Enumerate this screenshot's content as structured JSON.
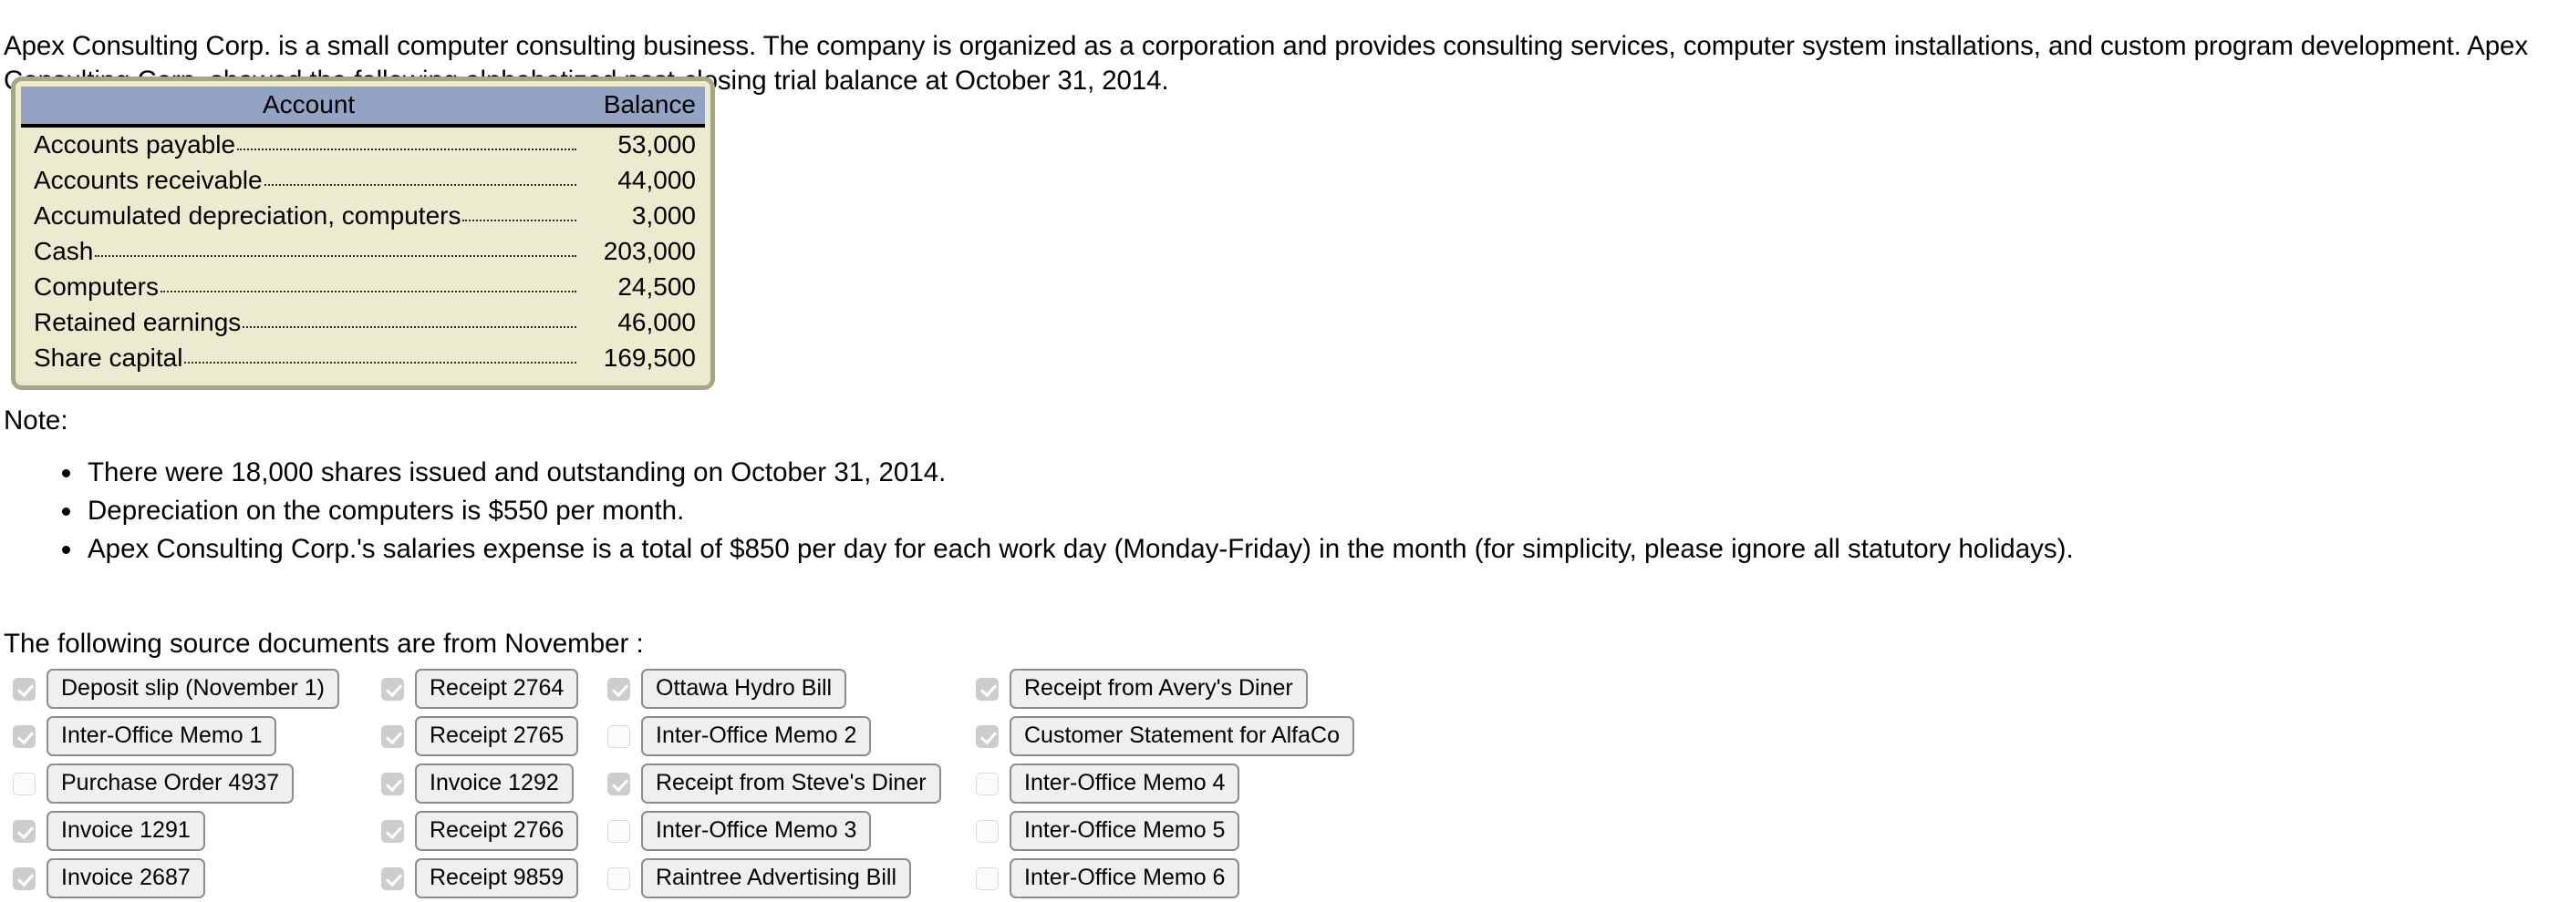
{
  "intro": {
    "paragraph": "Apex Consulting Corp. is a small computer consulting business. The company is organized as a corporation and provides consulting services, computer system installations, and custom program development. Apex Consulting Corp. showed the following alphabetized post-closing trial balance at October 31, 2014."
  },
  "trial_balance": {
    "columns": {
      "account": "Account",
      "balance": "Balance"
    },
    "rows": [
      {
        "account": "Accounts payable",
        "balance": "53,000"
      },
      {
        "account": "Accounts receivable",
        "balance": "44,000"
      },
      {
        "account": "Accumulated depreciation, computers",
        "balance": "3,000"
      },
      {
        "account": "Cash",
        "balance": "203,000"
      },
      {
        "account": "Computers",
        "balance": "24,500"
      },
      {
        "account": "Retained earnings",
        "balance": "46,000"
      },
      {
        "account": "Share capital",
        "balance": "169,500"
      }
    ],
    "colors": {
      "header_background": "#93a3c4",
      "body_background": "#eceacf",
      "frame_border": "#a8a587"
    }
  },
  "note": {
    "label": "Note:",
    "items": [
      "There were 18,000 shares issued and outstanding on October 31, 2014.",
      "Depreciation on the computers is $550 per month.",
      "Apex Consulting Corp.'s salaries expense is a total of $850 per day for each work day (Monday-Friday) in the month (for simplicity, please ignore all statutory holidays)."
    ]
  },
  "source_documents": {
    "title": "The following source documents are from November :",
    "columns": [
      {
        "items": [
          {
            "label": "Deposit slip (November 1)",
            "checked": true
          },
          {
            "label": "Inter-Office Memo 1",
            "checked": true
          },
          {
            "label": "Purchase Order 4937",
            "checked": false
          },
          {
            "label": "Invoice 1291",
            "checked": true
          },
          {
            "label": "Invoice 2687",
            "checked": true
          }
        ]
      },
      {
        "items": [
          {
            "label": "Receipt 2764",
            "checked": true
          },
          {
            "label": "Receipt 2765",
            "checked": true
          },
          {
            "label": "Invoice 1292",
            "checked": true
          },
          {
            "label": "Receipt 2766",
            "checked": true
          },
          {
            "label": "Receipt 9859",
            "checked": true
          }
        ]
      },
      {
        "items": [
          {
            "label": "Ottawa Hydro Bill",
            "checked": true
          },
          {
            "label": "Inter-Office Memo 2",
            "checked": false
          },
          {
            "label": "Receipt from Steve's Diner",
            "checked": true
          },
          {
            "label": "Inter-Office Memo 3",
            "checked": false
          },
          {
            "label": "Raintree Advertising Bill",
            "checked": false
          }
        ]
      },
      {
        "items": [
          {
            "label": "Receipt from Avery's Diner",
            "checked": true
          },
          {
            "label": "Customer Statement for AlfaCo",
            "checked": true
          },
          {
            "label": "Inter-Office Memo 4",
            "checked": false
          },
          {
            "label": "Inter-Office Memo 5",
            "checked": false
          },
          {
            "label": "Inter-Office Memo 6",
            "checked": false
          }
        ]
      }
    ]
  }
}
